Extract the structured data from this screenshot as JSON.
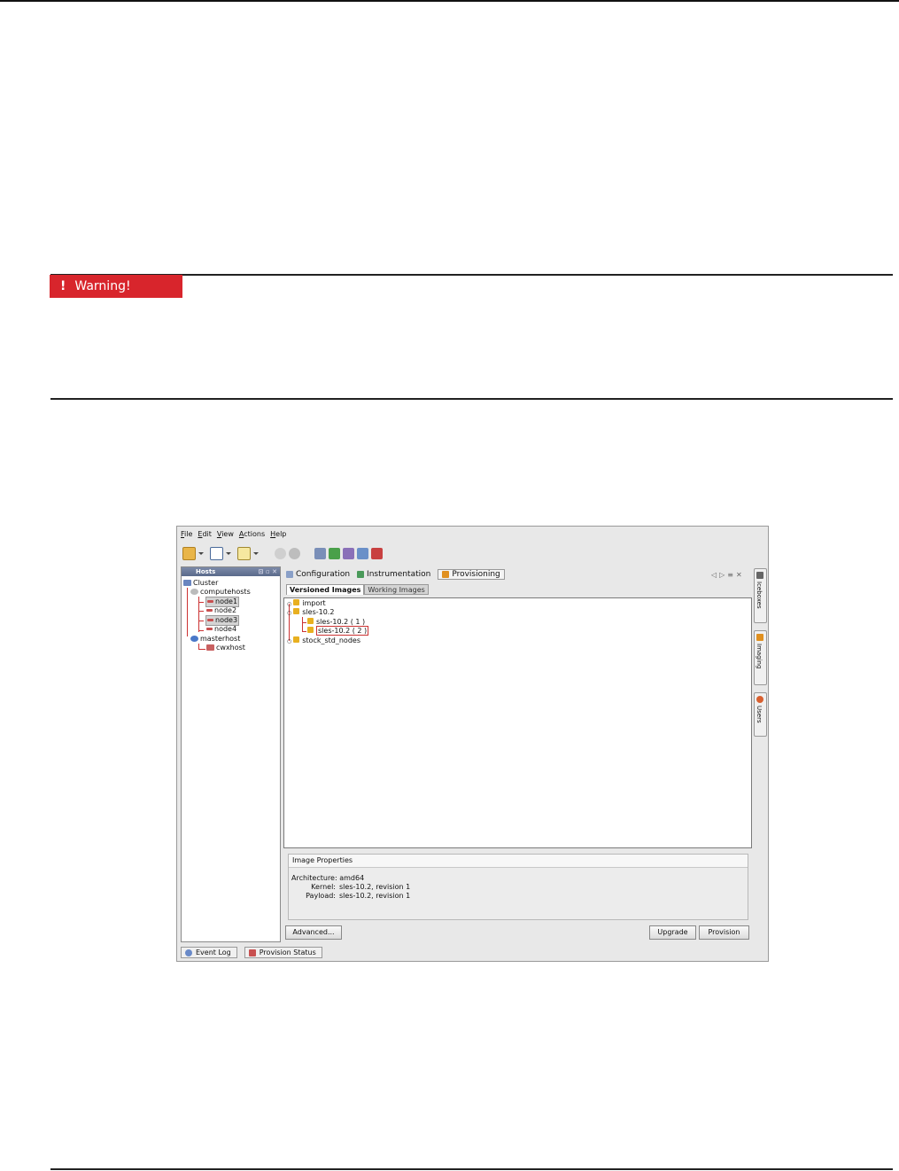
{
  "warning": {
    "label": "Warning!",
    "mark": "!"
  },
  "app": {
    "menu": [
      "File",
      "Edit",
      "View",
      "Actions",
      "Help"
    ],
    "hosts_panel": {
      "title": "Hosts",
      "tree": {
        "root": "Cluster",
        "groups": [
          {
            "name": "computehosts",
            "items": [
              "node1",
              "node2",
              "node3",
              "node4"
            ]
          },
          {
            "name": "masterhost",
            "items": [
              "cwxhost"
            ]
          }
        ]
      }
    },
    "tabs": [
      "Configuration",
      "Instrumentation",
      "Provisioning"
    ],
    "active_tab": "Provisioning",
    "subtabs": [
      "Versioned Images",
      "Working Images"
    ],
    "image_tree": {
      "items": [
        "import",
        "sles-10.2",
        "stock_std_nodes"
      ],
      "sles_children": [
        "sles-10.2 ( 1 )",
        "sles-10.2 ( 2 )"
      ]
    },
    "properties": {
      "title": "Image Properties",
      "rows": [
        {
          "key": "Architecture:",
          "value": "amd64"
        },
        {
          "key": "Kernel:",
          "value": "sles-10.2, revision 1"
        },
        {
          "key": "Payload:",
          "value": "sles-10.2, revision 1"
        }
      ]
    },
    "buttons": {
      "advanced": "Advanced...",
      "upgrade": "Upgrade",
      "provision": "Provision"
    },
    "side_tabs": [
      "Iceboxes",
      "Imaging",
      "Users"
    ],
    "bottom_tabs": [
      "Event Log",
      "Provision Status"
    ]
  }
}
